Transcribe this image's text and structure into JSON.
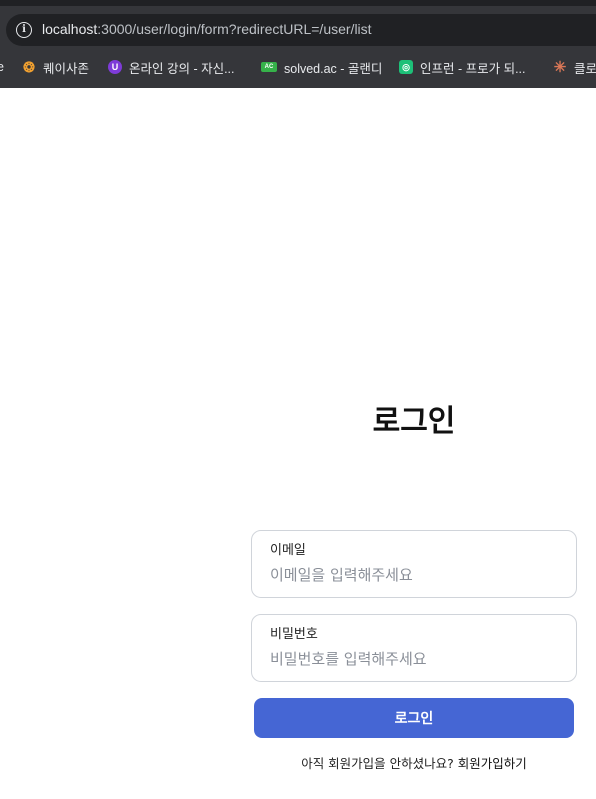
{
  "browser": {
    "url_host": "localhost",
    "url_rest": ":3000/user/login/form?redirectURL=/user/list",
    "bookmarks": [
      {
        "label": "e"
      },
      {
        "label": "퀘이사존"
      },
      {
        "label": "온라인 강의 - 자신..."
      },
      {
        "label": "solved.ac - 골랜디"
      },
      {
        "label": "인프런 - 프로가 되..."
      },
      {
        "label": "클로"
      }
    ]
  },
  "page": {
    "title": "로그인",
    "email": {
      "label": "이메일",
      "placeholder": "이메일을 입력해주세요",
      "value": ""
    },
    "password": {
      "label": "비밀번호",
      "placeholder": "비밀번호를 입력해주세요",
      "value": ""
    },
    "submit_label": "로그인",
    "signup_prompt": "아직 회원가입을 안하셨나요?",
    "signup_link": "회원가입하기"
  },
  "colors": {
    "primary": "#4566d4",
    "chrome_bg": "#35363a"
  }
}
